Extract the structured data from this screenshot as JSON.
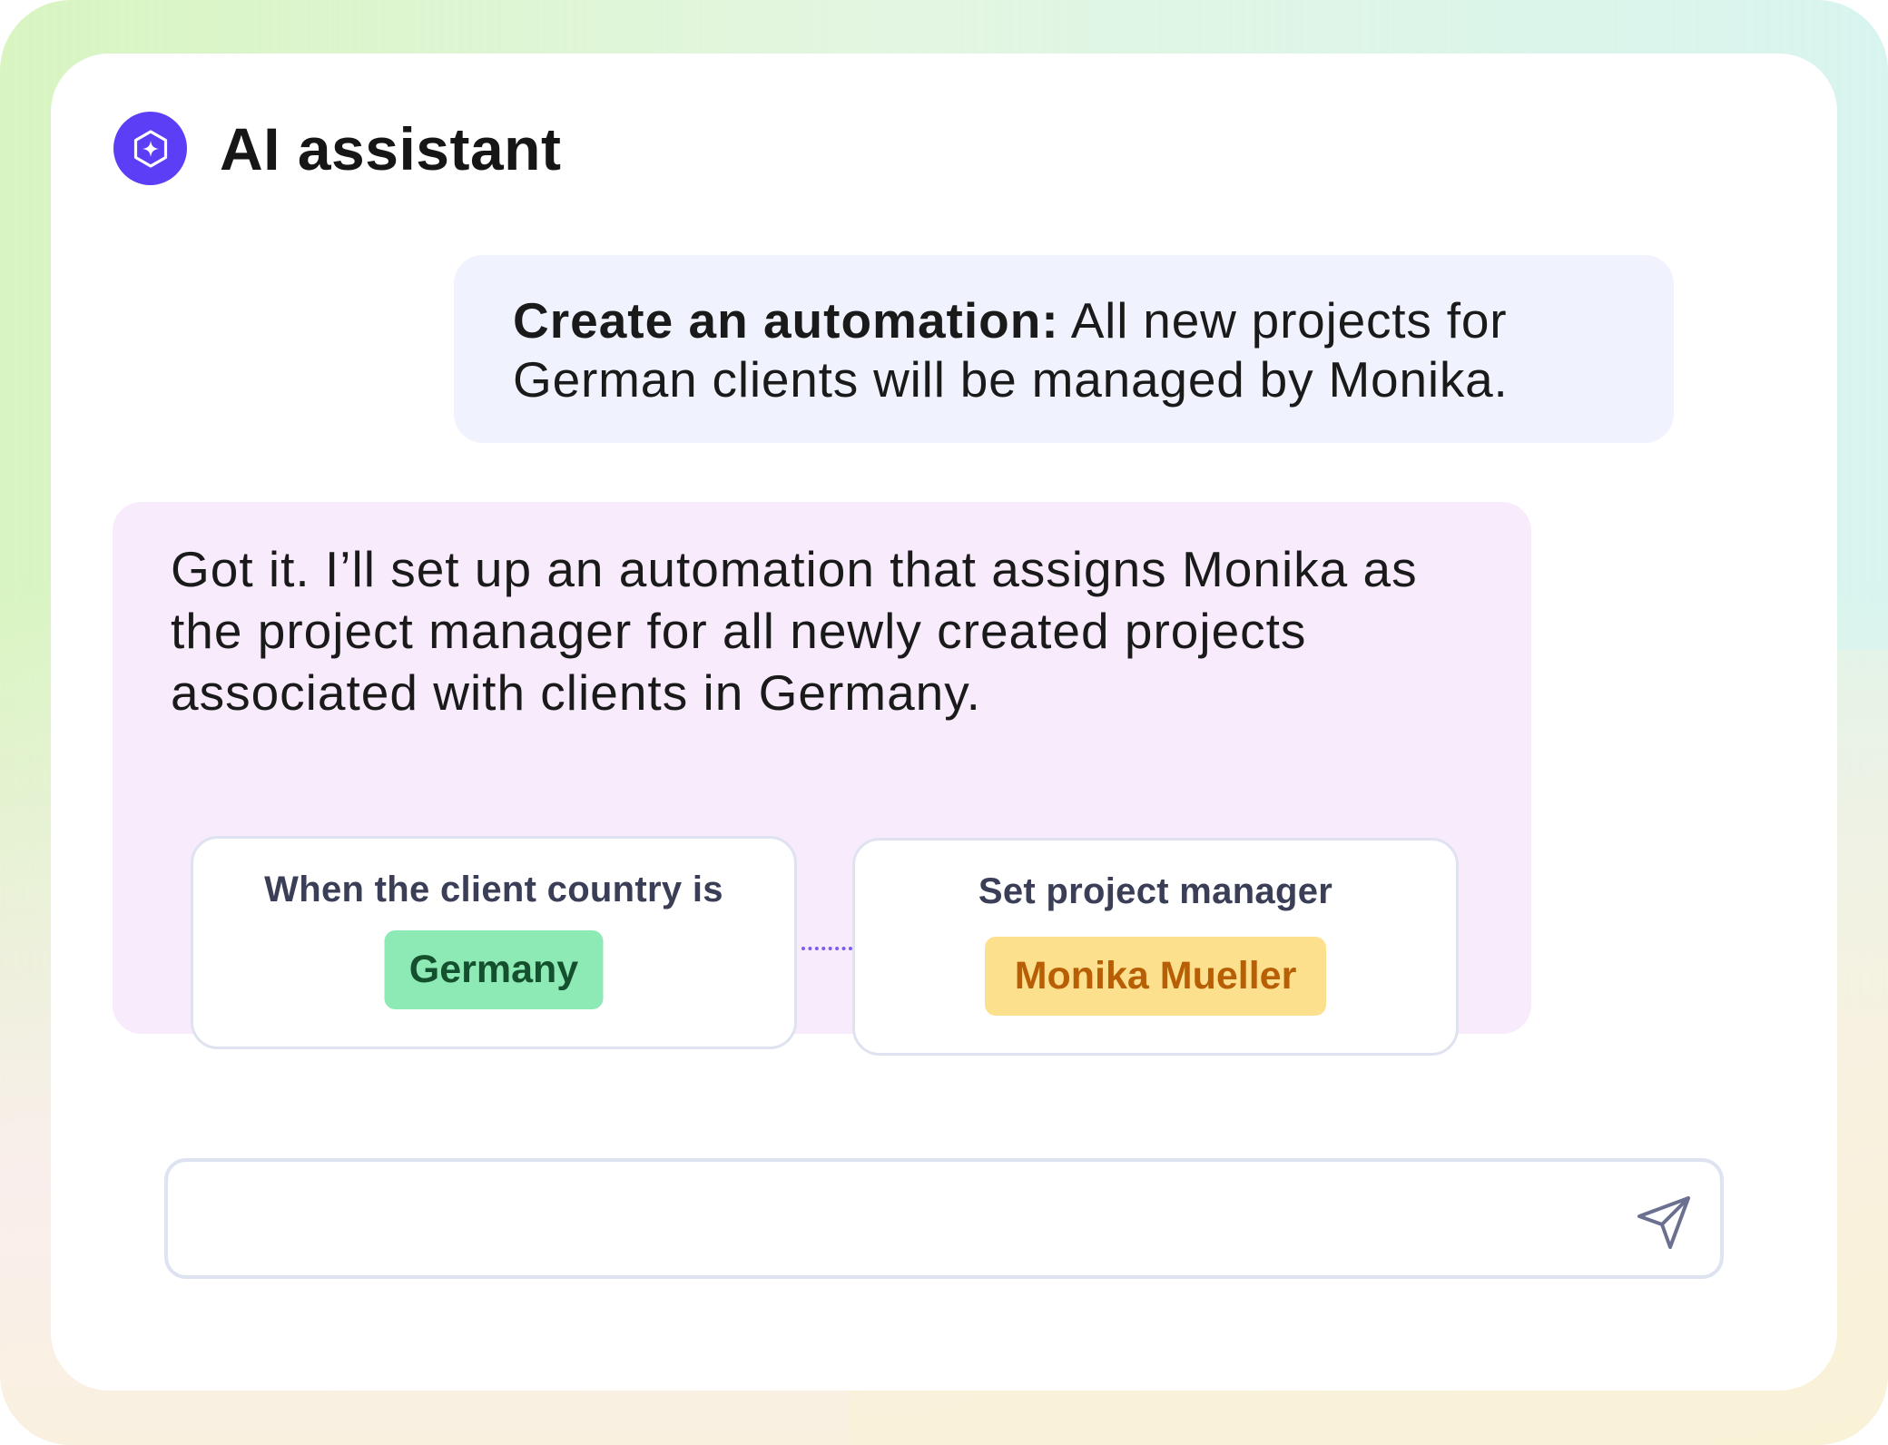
{
  "header": {
    "title": "AI assistant",
    "logo_icon": "sparkle-hexagon-icon"
  },
  "user_message": {
    "bold": "Create an automation:",
    "text": " All new projects for German clients will be managed by Monika."
  },
  "assistant_message": {
    "text": "Got it. I’ll set up an automation that assigns Monika as the project manager for all newly created projects associated with clients in Germany.",
    "trigger_card": {
      "label": "When the client country is",
      "value": "Germany"
    },
    "action_card": {
      "label": "Set project manager",
      "value": "Monika Mueller"
    }
  },
  "composer": {
    "value": "",
    "send_icon": "send-icon"
  },
  "colors": {
    "accent": "#5b3ef5",
    "user_bubble": "#f0f3fd",
    "assistant_bubble": "#f7ebfc",
    "chip_green": "#8eeab4",
    "chip_yellow": "#fde08e"
  }
}
